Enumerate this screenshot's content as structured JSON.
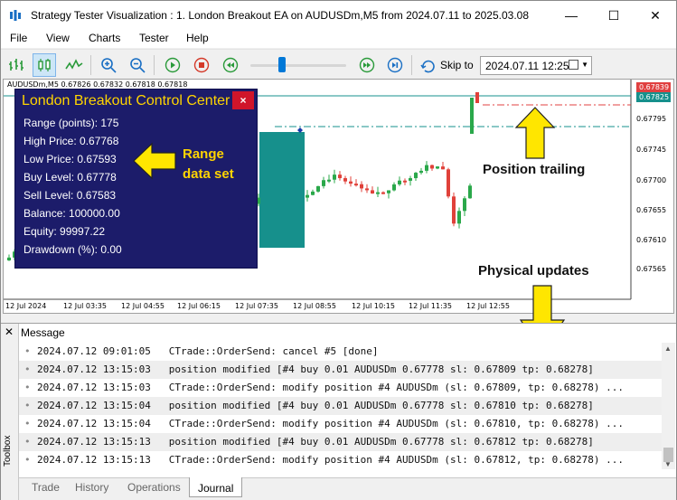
{
  "window": {
    "title": "Strategy Tester Visualization : 1. London Breakout EA on AUDUSDm,M5 from 2024.07.11 to 2025.03.08",
    "minimize": "—",
    "maximize": "☐",
    "close": "✕"
  },
  "menu": {
    "items": [
      "File",
      "View",
      "Charts",
      "Tester",
      "Help"
    ]
  },
  "toolbar": {
    "skip_label": "Skip to",
    "skip_value": "2024.07.11 12:25",
    "speed_slider_fraction": 0.3
  },
  "chart": {
    "header": "AUDUSDm,M5  0.67826 0.67832 0.67818 0.67818",
    "price_axis": [
      "0.67795",
      "0.67745",
      "0.67700",
      "0.67655",
      "0.67610",
      "0.67565"
    ],
    "tags": {
      "red": "0.67839",
      "teal": "0.67825"
    },
    "time_axis": [
      "12 Jul 2024",
      "12 Jul 03:35",
      "12 Jul 04:55",
      "12 Jul 06:15",
      "12 Jul 07:35",
      "12 Jul 08:55",
      "12 Jul 10:15",
      "12 Jul 11:35",
      "12 Jul 12:55"
    ],
    "colors": {
      "bull": "#2aa84a",
      "bear": "#e0413a",
      "range_box": "#16908c",
      "stop_line": "#e04040",
      "level_line": "#16908c"
    }
  },
  "panel": {
    "title": "London Breakout Control Center",
    "close": "×",
    "rows": [
      "Range (points): 175",
      "High Price: 0.67768",
      "Low Price: 0.67593",
      "Buy Level: 0.67778",
      "Sell Level: 0.67583",
      "Balance: 100000.00",
      "Equity: 99997.22",
      "Drawdown (%): 0.00"
    ]
  },
  "annotations": {
    "range": "Range\ndata set",
    "range_line1": "Range",
    "range_line2": "data set",
    "trailing": "Position trailing",
    "physical": "Physical updates"
  },
  "toolbox": {
    "label": "Toolbox",
    "header": "Message",
    "log": [
      {
        "time": "2024.07.12 09:01:05",
        "msg": "CTrade::OrderSend: cancel #5 [done]"
      },
      {
        "time": "2024.07.12 13:15:03",
        "msg": "position modified [#4 buy 0.01 AUDUSDm 0.67778 sl: 0.67809 tp: 0.68278]"
      },
      {
        "time": "2024.07.12 13:15:03",
        "msg": "CTrade::OrderSend: modify position #4 AUDUSDm (sl: 0.67809, tp: 0.68278) ..."
      },
      {
        "time": "2024.07.12 13:15:04",
        "msg": "position modified [#4 buy 0.01 AUDUSDm 0.67778 sl: 0.67810 tp: 0.68278]"
      },
      {
        "time": "2024.07.12 13:15:04",
        "msg": "CTrade::OrderSend: modify position #4 AUDUSDm (sl: 0.67810, tp: 0.68278) ..."
      },
      {
        "time": "2024.07.12 13:15:13",
        "msg": "position modified [#4 buy 0.01 AUDUSDm 0.67778 sl: 0.67812 tp: 0.68278]"
      },
      {
        "time": "2024.07.12 13:15:13",
        "msg": "CTrade::OrderSend: modify position #4 AUDUSDm (sl: 0.67812, tp: 0.68278) ..."
      }
    ],
    "tabs": [
      "Trade",
      "History",
      "Operations",
      "Journal"
    ]
  }
}
